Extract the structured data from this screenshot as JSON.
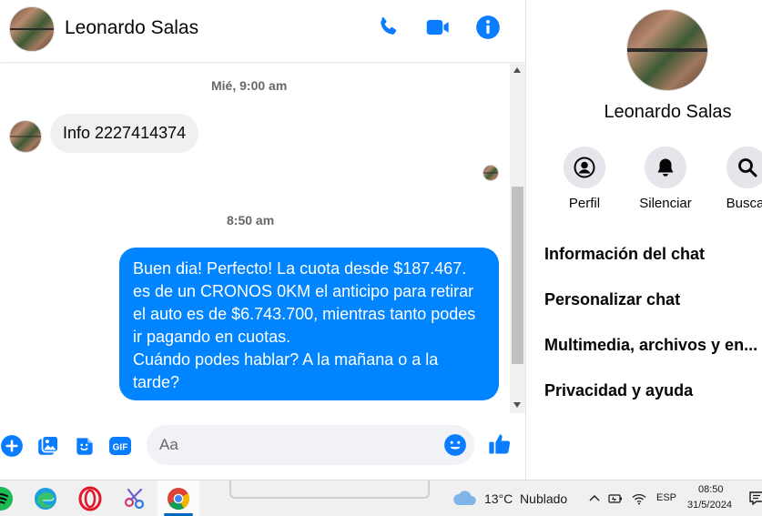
{
  "chat": {
    "contact_name": "Leonardo Salas",
    "timestamps": [
      "Mié, 9:00 am",
      "8:50 am"
    ],
    "incoming_message": "Info 2227414374",
    "outgoing_message": "Buen dia! Perfecto! La cuota desde $187.467.\nes de un CRONOS 0KM el anticipo para retirar\nel auto es de $6.743.700, mientras tanto podes\nir pagando en cuotas.\nCuándo podes hablar? A la mañana o a la\ntarde?",
    "composer_placeholder": "Aa"
  },
  "info_panel": {
    "name": "Leonardo Salas",
    "actions": [
      {
        "label": "Perfil",
        "icon": "profile-icon"
      },
      {
        "label": "Silenciar",
        "icon": "bell-icon"
      },
      {
        "label": "Buscar",
        "icon": "search-icon"
      }
    ],
    "menu": [
      "Información del chat",
      "Personalizar chat",
      "Multimedia, archivos y en...",
      "Privacidad y ayuda"
    ]
  },
  "taskbar": {
    "weather": "13°C  Nublado",
    "language": "ESP",
    "time": "08:50",
    "date": "31/5/2024"
  },
  "colors": {
    "accent": "#0084ff",
    "icon_blue": "#0a7cff",
    "bubble_incoming": "#f0f0f0"
  }
}
